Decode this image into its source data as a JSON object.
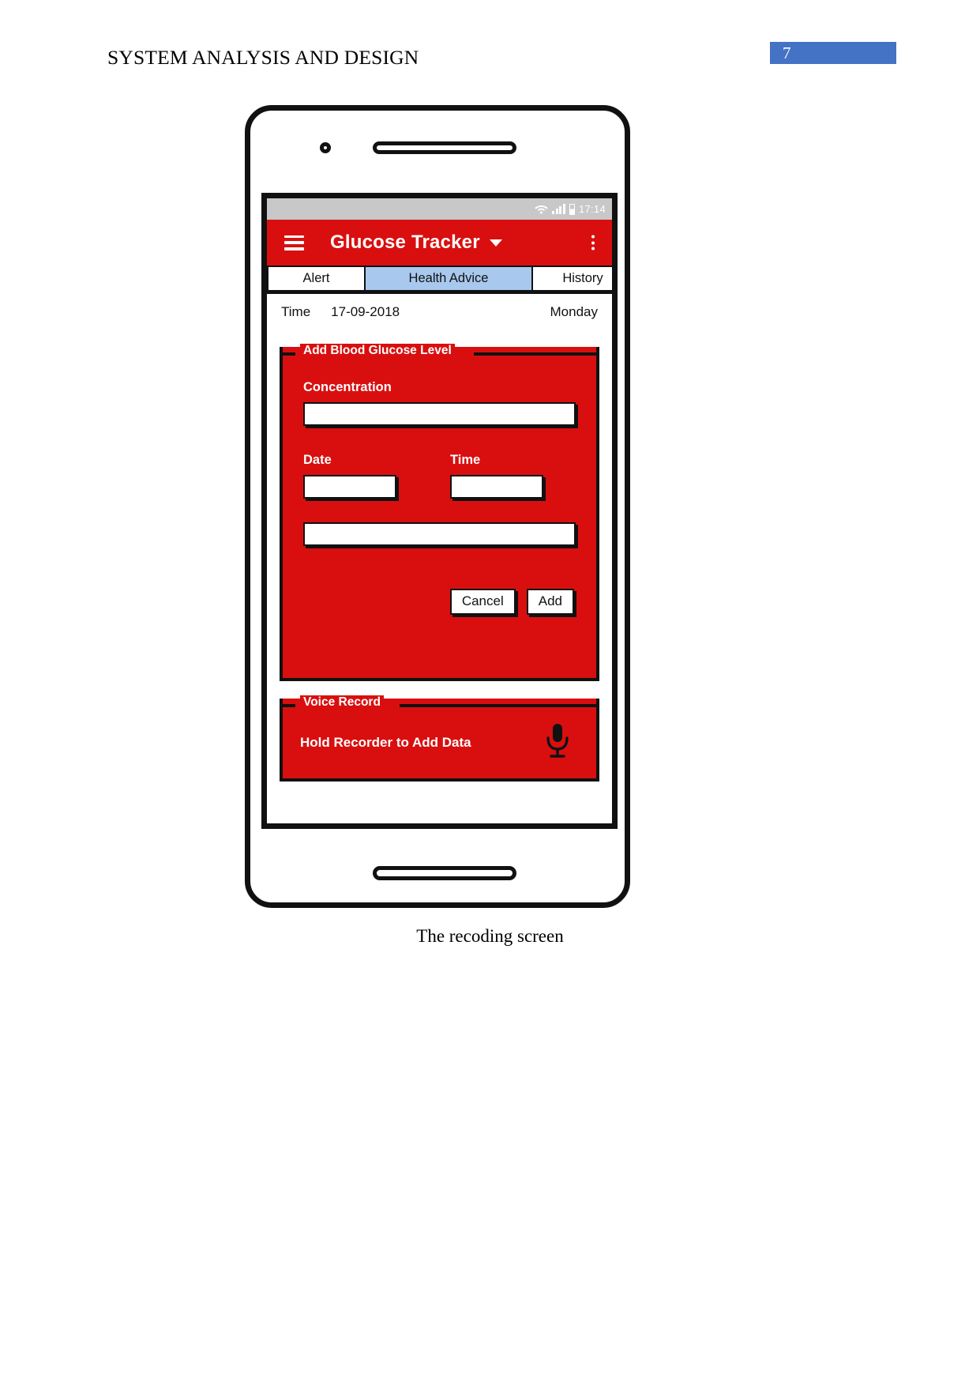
{
  "document": {
    "header_title": "SYSTEM ANALYSIS AND DESIGN",
    "page_number": "7",
    "page_number_box_color": "#4472C4",
    "caption": "The recoding screen"
  },
  "phone": {
    "camera_icon": "camera-dot-icon",
    "speaker_icon": "earpiece-speaker-icon",
    "home_icon": "home-bar-icon"
  },
  "screen": {
    "status_bar": {
      "wifi_icon": "wifi-icon",
      "signal_icon": "cellular-signal-icon",
      "battery_icon": "battery-icon",
      "time": "17:14",
      "background_color": "#c8c8c8"
    },
    "app_bar": {
      "menu_icon": "hamburger-menu-icon",
      "title": "Glucose Tracker",
      "dropdown_icon": "chevron-down-icon",
      "overflow_icon": "overflow-menu-icon",
      "background_color": "#d90f0f"
    },
    "tabs": [
      {
        "label": "Alert",
        "active": false
      },
      {
        "label": "Health Advice",
        "active": true
      },
      {
        "label": "History",
        "active": false
      }
    ],
    "active_tab_color": "#a8c8ee",
    "date_row": {
      "time_label": "Time",
      "date_value": "17-09-2018",
      "day_value": "Monday"
    },
    "glucose_panel": {
      "legend": "Add Blood Glucose Level",
      "background_color": "#d90f0f",
      "concentration_label": "Concentration",
      "concentration_value": "",
      "concentration_placeholder": "",
      "date_label": "Date",
      "date_value": "",
      "time_label": "Time",
      "time_value": "",
      "extra_field_value": "",
      "cancel_button": "Cancel",
      "add_button": "Add"
    },
    "voice_panel": {
      "legend": "Voice Record",
      "instruction": "Hold Recorder to Add Data",
      "mic_icon": "microphone-icon"
    }
  }
}
